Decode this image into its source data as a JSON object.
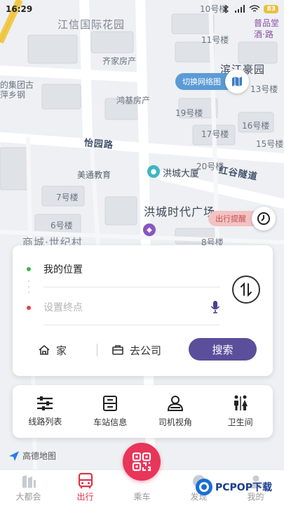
{
  "status_bar": {
    "time": "16:29",
    "battery": "83"
  },
  "map": {
    "labels": {
      "jiangxin": "江信国际花园",
      "qijia": "齐家房产",
      "honghe": "鸿基房产",
      "binjiang": "滨江豪园",
      "puping": "普品堂",
      "jiu_lu": "酒·路",
      "building_11": "11号楼",
      "building_10": "10号楼",
      "building_19": "19号楼",
      "building_17": "17号楼",
      "building_20": "20号楼",
      "building_16": "16号楼",
      "building_15": "15号楼",
      "building_13": "13号楼",
      "building_7": "7号楼",
      "building_6": "6号楼",
      "building_8": "8号楼",
      "yiyuan_road": "怡园路",
      "meitong": "美通教育",
      "hongcheng_tower": "洪城大厦",
      "honggu_tunnel": "红谷隧道",
      "hongcheng_plaza": "洪城时代广场",
      "shangcheng": "商城·世纪村",
      "left_group": "的集团古",
      "left_steel": "萍乡钢"
    }
  },
  "map_controls": {
    "switch_map_label": "切换网络图",
    "reminder_label": "出行提醒"
  },
  "route_card": {
    "from_label": "我的位置",
    "to_placeholder": "设置终点",
    "home_label": "家",
    "company_label": "去公司",
    "search_label": "搜索"
  },
  "services": [
    {
      "label": "线路列表",
      "icon": "route-list-icon"
    },
    {
      "label": "车站信息",
      "icon": "station-info-icon"
    },
    {
      "label": "司机视角",
      "icon": "driver-view-icon"
    },
    {
      "label": "卫生间",
      "icon": "restroom-icon"
    }
  ],
  "amap_logo": "高德地图",
  "tabs": [
    {
      "label": "大都会",
      "icon": "metropolis-icon"
    },
    {
      "label": "出行",
      "icon": "bus-icon"
    },
    {
      "label": "乘车",
      "icon": "qr-code-icon"
    },
    {
      "label": "发现",
      "icon": "discover-icon"
    },
    {
      "label": "我的",
      "icon": "profile-icon"
    }
  ],
  "watermark": "PCPOP下载",
  "colors": {
    "accent_purple": "#5b4f9c",
    "active_red": "#e0324b",
    "map_blue": "#5b9bd5",
    "reminder_red": "#c6504f"
  }
}
